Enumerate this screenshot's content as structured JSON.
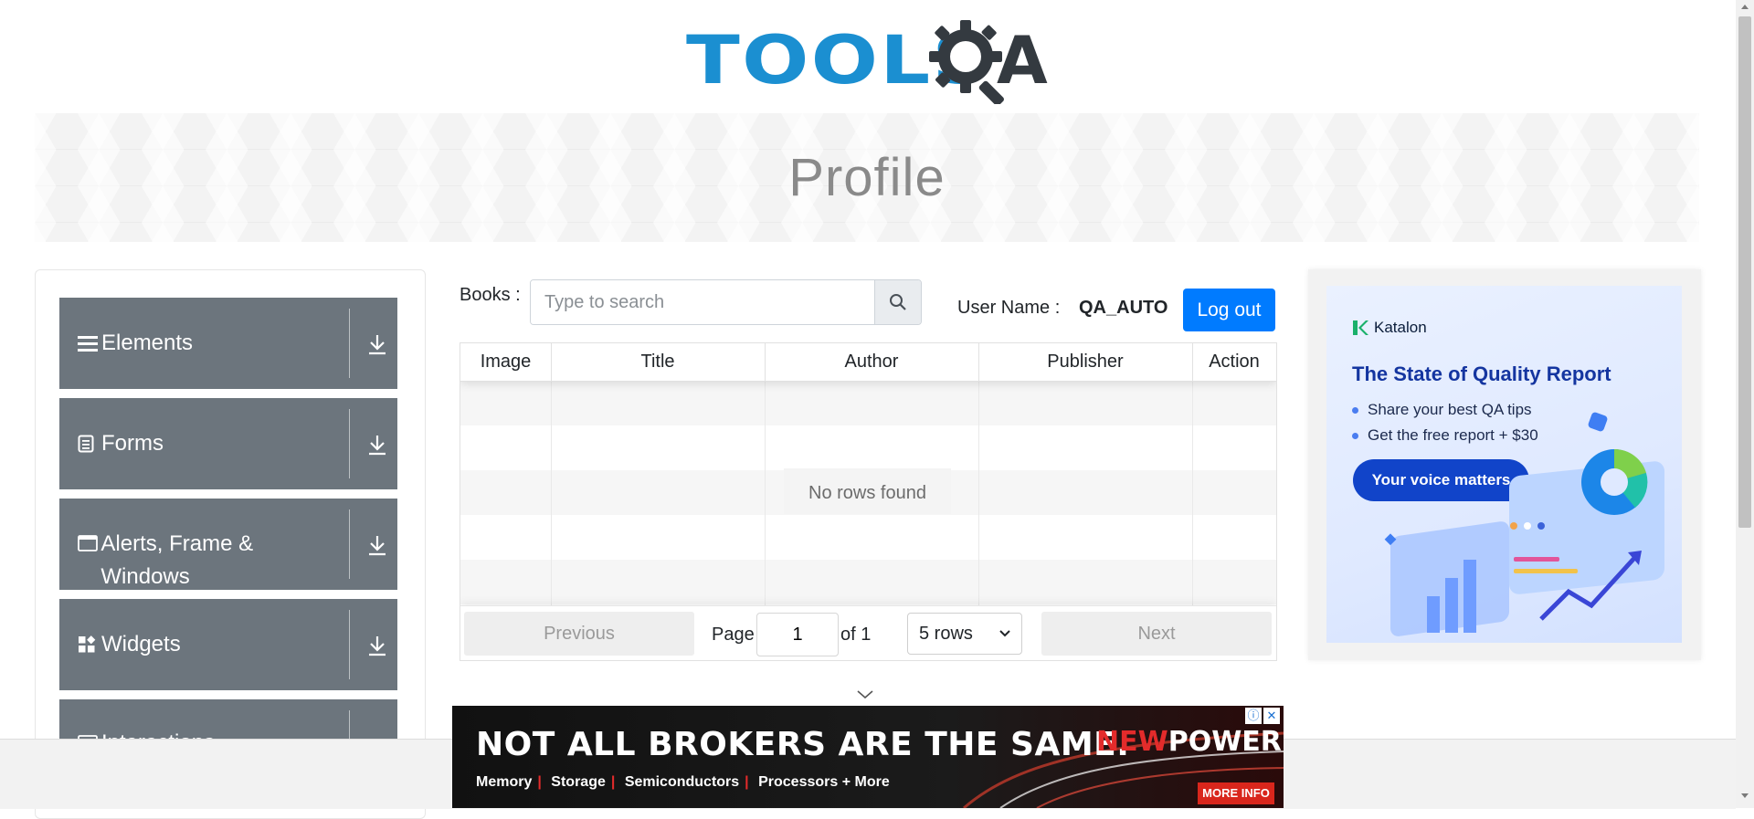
{
  "logo": {
    "text_tools": "TOOLS",
    "text_a": "A"
  },
  "banner": {
    "title": "Profile"
  },
  "sidebar": {
    "groups": [
      {
        "label": "Elements",
        "icon": "hamburger-icon"
      },
      {
        "label": "Forms",
        "icon": "document-icon"
      },
      {
        "label": "Alerts, Frame & Windows",
        "icon": "window-icon"
      },
      {
        "label": "Widgets",
        "icon": "widgets-icon"
      },
      {
        "label": "Interactions",
        "icon": "interactions-icon"
      }
    ]
  },
  "main": {
    "books_label": "Books :",
    "search_placeholder": "Type to search",
    "user_name_label": "User Name :",
    "user_name_value": "QA_AUTO",
    "logout_label": "Log out",
    "table": {
      "headers": [
        "Image",
        "Title",
        "Author",
        "Publisher",
        "Action"
      ],
      "empty_message": "No rows found"
    },
    "pagination": {
      "previous": "Previous",
      "page_label": "Page",
      "page_value": "1",
      "of_label": "of 1",
      "rows_option": "5 rows",
      "next": "Next"
    }
  },
  "right_ad": {
    "brand": "Katalon",
    "headline": "The State of Quality Report",
    "bullets": [
      "Share your best QA tips",
      "Get the free report + $30"
    ],
    "cta": "Your voice matters"
  },
  "bottom_ad": {
    "headline": "NOT ALL BROKERS ARE THE SAME.",
    "brand_new": "NEW",
    "brand_power": "POWER",
    "categories": [
      "Memory",
      "Storage",
      "Semiconductors",
      "Processors + More"
    ],
    "more": "MORE INFO"
  },
  "colors": {
    "accent": "#007bff",
    "nav_bg": "#6c757d",
    "logo_blue": "#1b8fd1",
    "logo_dark": "#343a40"
  }
}
